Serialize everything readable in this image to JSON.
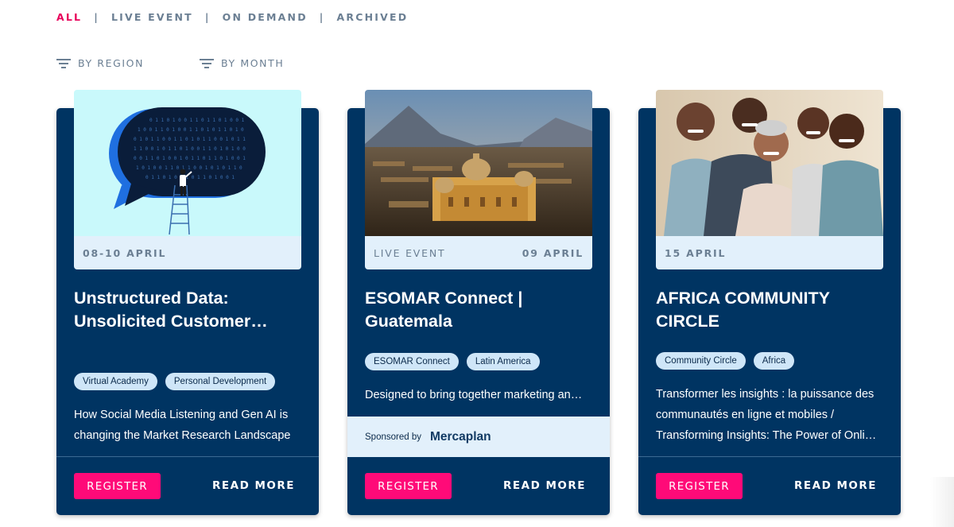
{
  "tabs": [
    {
      "label": "ALL",
      "active": true
    },
    {
      "label": "LIVE EVENT",
      "active": false
    },
    {
      "label": "ON DEMAND",
      "active": false
    },
    {
      "label": "ARCHIVED",
      "active": false
    }
  ],
  "tab_separator": "|",
  "filters": [
    {
      "label": "BY REGION",
      "icon": "filter-icon"
    },
    {
      "label": "BY MONTH",
      "icon": "filter-icon"
    }
  ],
  "colors": {
    "accent": "#e8005a",
    "card_bg": "#003462",
    "register_bg": "#ff0a78",
    "datebar_bg": "#e2f0fb",
    "tag_bg": "#cfe6f8"
  },
  "cards": [
    {
      "image": "speech-bubble-binary-illustration",
      "type": "",
      "date": "08-10 APRIL",
      "title": "Unstructured Data: Unsolicited Customer…",
      "tags": [
        "Virtual Academy",
        "Personal Development"
      ],
      "description": "How Social Media Listening and Gen AI is changing the Market Research Landscape",
      "register_label": "REGISTER",
      "read_more_label": "READ MORE"
    },
    {
      "image": "guatemala-city-photo",
      "type": "LIVE EVENT",
      "date": "09 APRIL",
      "title": "ESOMAR Connect | Guatemala",
      "tags": [
        "ESOMAR Connect",
        "Latin America"
      ],
      "description": "Designed to bring together marketing an…",
      "sponsor": {
        "label": "Sponsored by",
        "name": "Mercaplan"
      },
      "register_label": "REGISTER",
      "read_more_label": "READ MORE"
    },
    {
      "image": "group-of-people-photo",
      "type": "",
      "date": "15 APRIL",
      "title": "AFRICA COMMUNITY CIRCLE",
      "tags": [
        "Community Circle",
        "Africa"
      ],
      "description": "Transformer les insights : la puissance des communautés en ligne et mobiles / Transforming Insights: The Power of Onli…",
      "register_label": "REGISTER",
      "read_more_label": "READ MORE"
    }
  ]
}
